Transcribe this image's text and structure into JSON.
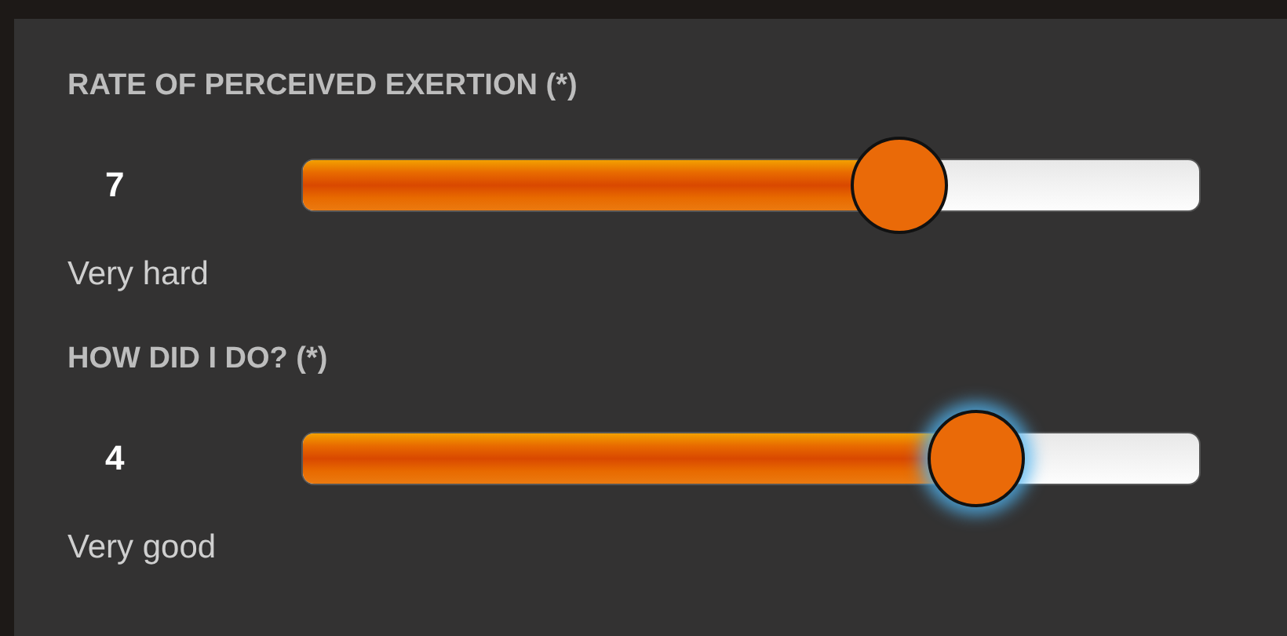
{
  "sliders": [
    {
      "label": "RATE OF PERCEIVED EXERTION (*)",
      "value": "7",
      "level": 0.665,
      "description": "Very hard",
      "focused": false
    },
    {
      "label": "HOW DID I DO? (*)",
      "value": "4",
      "level": 0.75,
      "description": "Very good",
      "focused": true
    }
  ]
}
